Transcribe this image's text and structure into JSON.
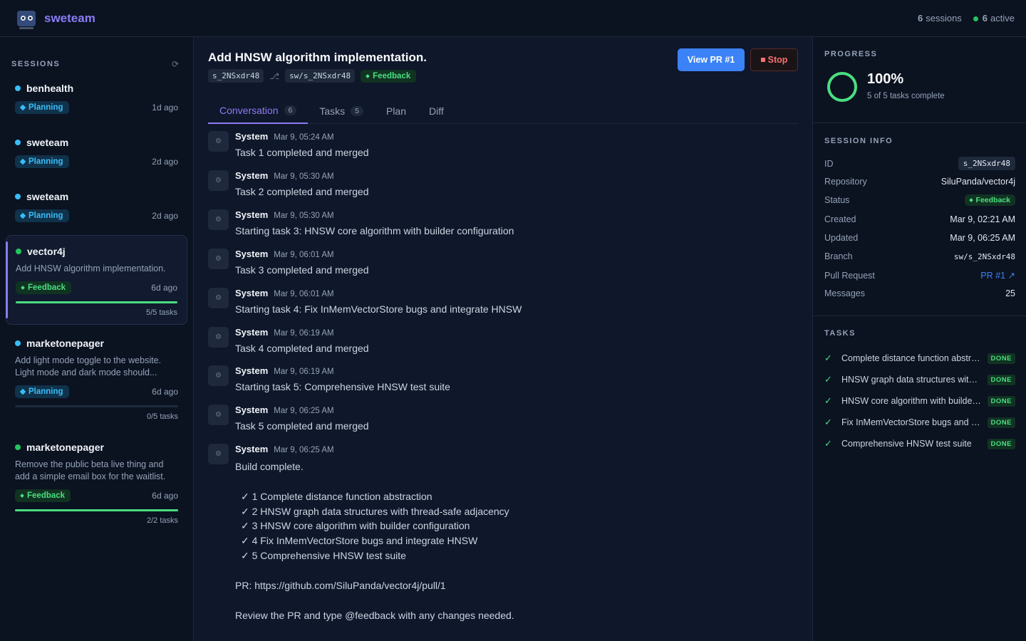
{
  "app": {
    "name": "sweteam"
  },
  "topbar": {
    "sessions_count": "6",
    "sessions_label": "sessions",
    "active_count": "6",
    "active_label": "active"
  },
  "sidebar": {
    "heading": "SESSIONS",
    "refresh_icon": "⟳",
    "sessions": [
      {
        "name": "benhealth",
        "status": "Planning",
        "ago": "1d ago"
      },
      {
        "name": "sweteam",
        "status": "Planning",
        "ago": "2d ago"
      },
      {
        "name": "sweteam",
        "status": "Planning",
        "ago": "2d ago"
      },
      {
        "name": "vector4j",
        "desc": "Add HNSW algorithm implementation.",
        "status": "Feedback",
        "ago": "6d ago",
        "progress_fraction": 1.0,
        "progress_text": "5/5 tasks"
      },
      {
        "name": "marketonepager",
        "desc1": "Add light mode toggle to the website.",
        "desc2": "Light mode and dark mode should...",
        "status": "Planning",
        "ago": "6d ago",
        "progress_fraction": 0.0,
        "progress_text": "0/5 tasks"
      },
      {
        "name": "marketonepager",
        "desc1": "Remove the public beta live thing and",
        "desc2": "add a simple email box for the waitlist.",
        "status": "Feedback",
        "ago": "6d ago",
        "progress_fraction": 1.0,
        "progress_text": "2/2 tasks"
      }
    ]
  },
  "main": {
    "title": "Add HNSW algorithm implementation.",
    "session_id": "s_2NSxdr48",
    "branch_icon": "⎇",
    "branch": "sw/s_2NSxdr48",
    "status": "Feedback",
    "view_pr_label": "View PR #1",
    "stop_label": "Stop",
    "tabs": [
      {
        "label": "Conversation",
        "count": "6"
      },
      {
        "label": "Tasks",
        "count": "5"
      },
      {
        "label": "Plan"
      },
      {
        "label": "Diff"
      }
    ],
    "messages": [
      {
        "who": "System",
        "ts": "Mar 9, 05:24 AM",
        "text": "Task 1 completed and merged"
      },
      {
        "who": "System",
        "ts": "Mar 9, 05:30 AM",
        "text": "Task 2 completed and merged"
      },
      {
        "who": "System",
        "ts": "Mar 9, 05:30 AM",
        "text": "Starting task 3: HNSW core algorithm with builder configuration"
      },
      {
        "who": "System",
        "ts": "Mar 9, 06:01 AM",
        "text": "Task 3 completed and merged"
      },
      {
        "who": "System",
        "ts": "Mar 9, 06:01 AM",
        "text": "Starting task 4: Fix InMemVectorStore bugs and integrate HNSW"
      },
      {
        "who": "System",
        "ts": "Mar 9, 06:19 AM",
        "text": "Task 4 completed and merged"
      },
      {
        "who": "System",
        "ts": "Mar 9, 06:19 AM",
        "text": "Starting task 5: Comprehensive HNSW test suite"
      },
      {
        "who": "System",
        "ts": "Mar 9, 06:25 AM",
        "text": "Task 5 completed and merged"
      }
    ],
    "final_message": {
      "who": "System",
      "ts": "Mar 9, 06:25 AM",
      "line1": "Build complete.",
      "items": [
        "✓ 1  Complete distance function abstraction",
        "✓ 2  HNSW graph data structures with thread-safe adjacency",
        "✓ 3  HNSW core algorithm with builder configuration",
        "✓ 4  Fix InMemVectorStore bugs and integrate HNSW",
        "✓ 5  Comprehensive HNSW test suite"
      ],
      "pr_line": "PR: https://github.com/SiluPanda/vector4j/pull/1",
      "review_line": "Review the PR and type @feedback with any changes needed."
    }
  },
  "right": {
    "progress_heading": "PROGRESS",
    "progress_fraction": 1.0,
    "progress_pct": "100%",
    "progress_sub": "5 of 5 tasks complete",
    "info_heading": "SESSION INFO",
    "info": {
      "id_label": "ID",
      "id": "s_2NSxdr48",
      "repo_label": "Repository",
      "repo": "SiluPanda/vector4j",
      "status_label": "Status",
      "status": "Feedback",
      "created_label": "Created",
      "created": "Mar 9, 02:21 AM",
      "updated_label": "Updated",
      "updated": "Mar 9, 06:25 AM",
      "branch_label": "Branch",
      "branch": "sw/s_2NSxdr48",
      "pr_label": "Pull Request",
      "pr": "PR #1 ↗",
      "messages_label": "Messages",
      "messages": "25"
    },
    "tasks_heading": "TASKS",
    "tasks": [
      {
        "label": "Complete distance function abstraction",
        "state": "DONE"
      },
      {
        "label": "HNSW graph data structures with thread-safe adjacency",
        "state": "DONE"
      },
      {
        "label": "HNSW core algorithm with builder configuration",
        "state": "DONE"
      },
      {
        "label": "Fix InMemVectorStore bugs and integrate HNSW",
        "state": "DONE"
      },
      {
        "label": "Comprehensive HNSW test suite",
        "state": "DONE"
      }
    ],
    "check_icon": "✓"
  },
  "colors": {
    "accent": "#8b7cf6",
    "primary": "#3b82f6",
    "success": "#4ade80",
    "planning": "#38bdf8",
    "danger": "#f87171"
  }
}
